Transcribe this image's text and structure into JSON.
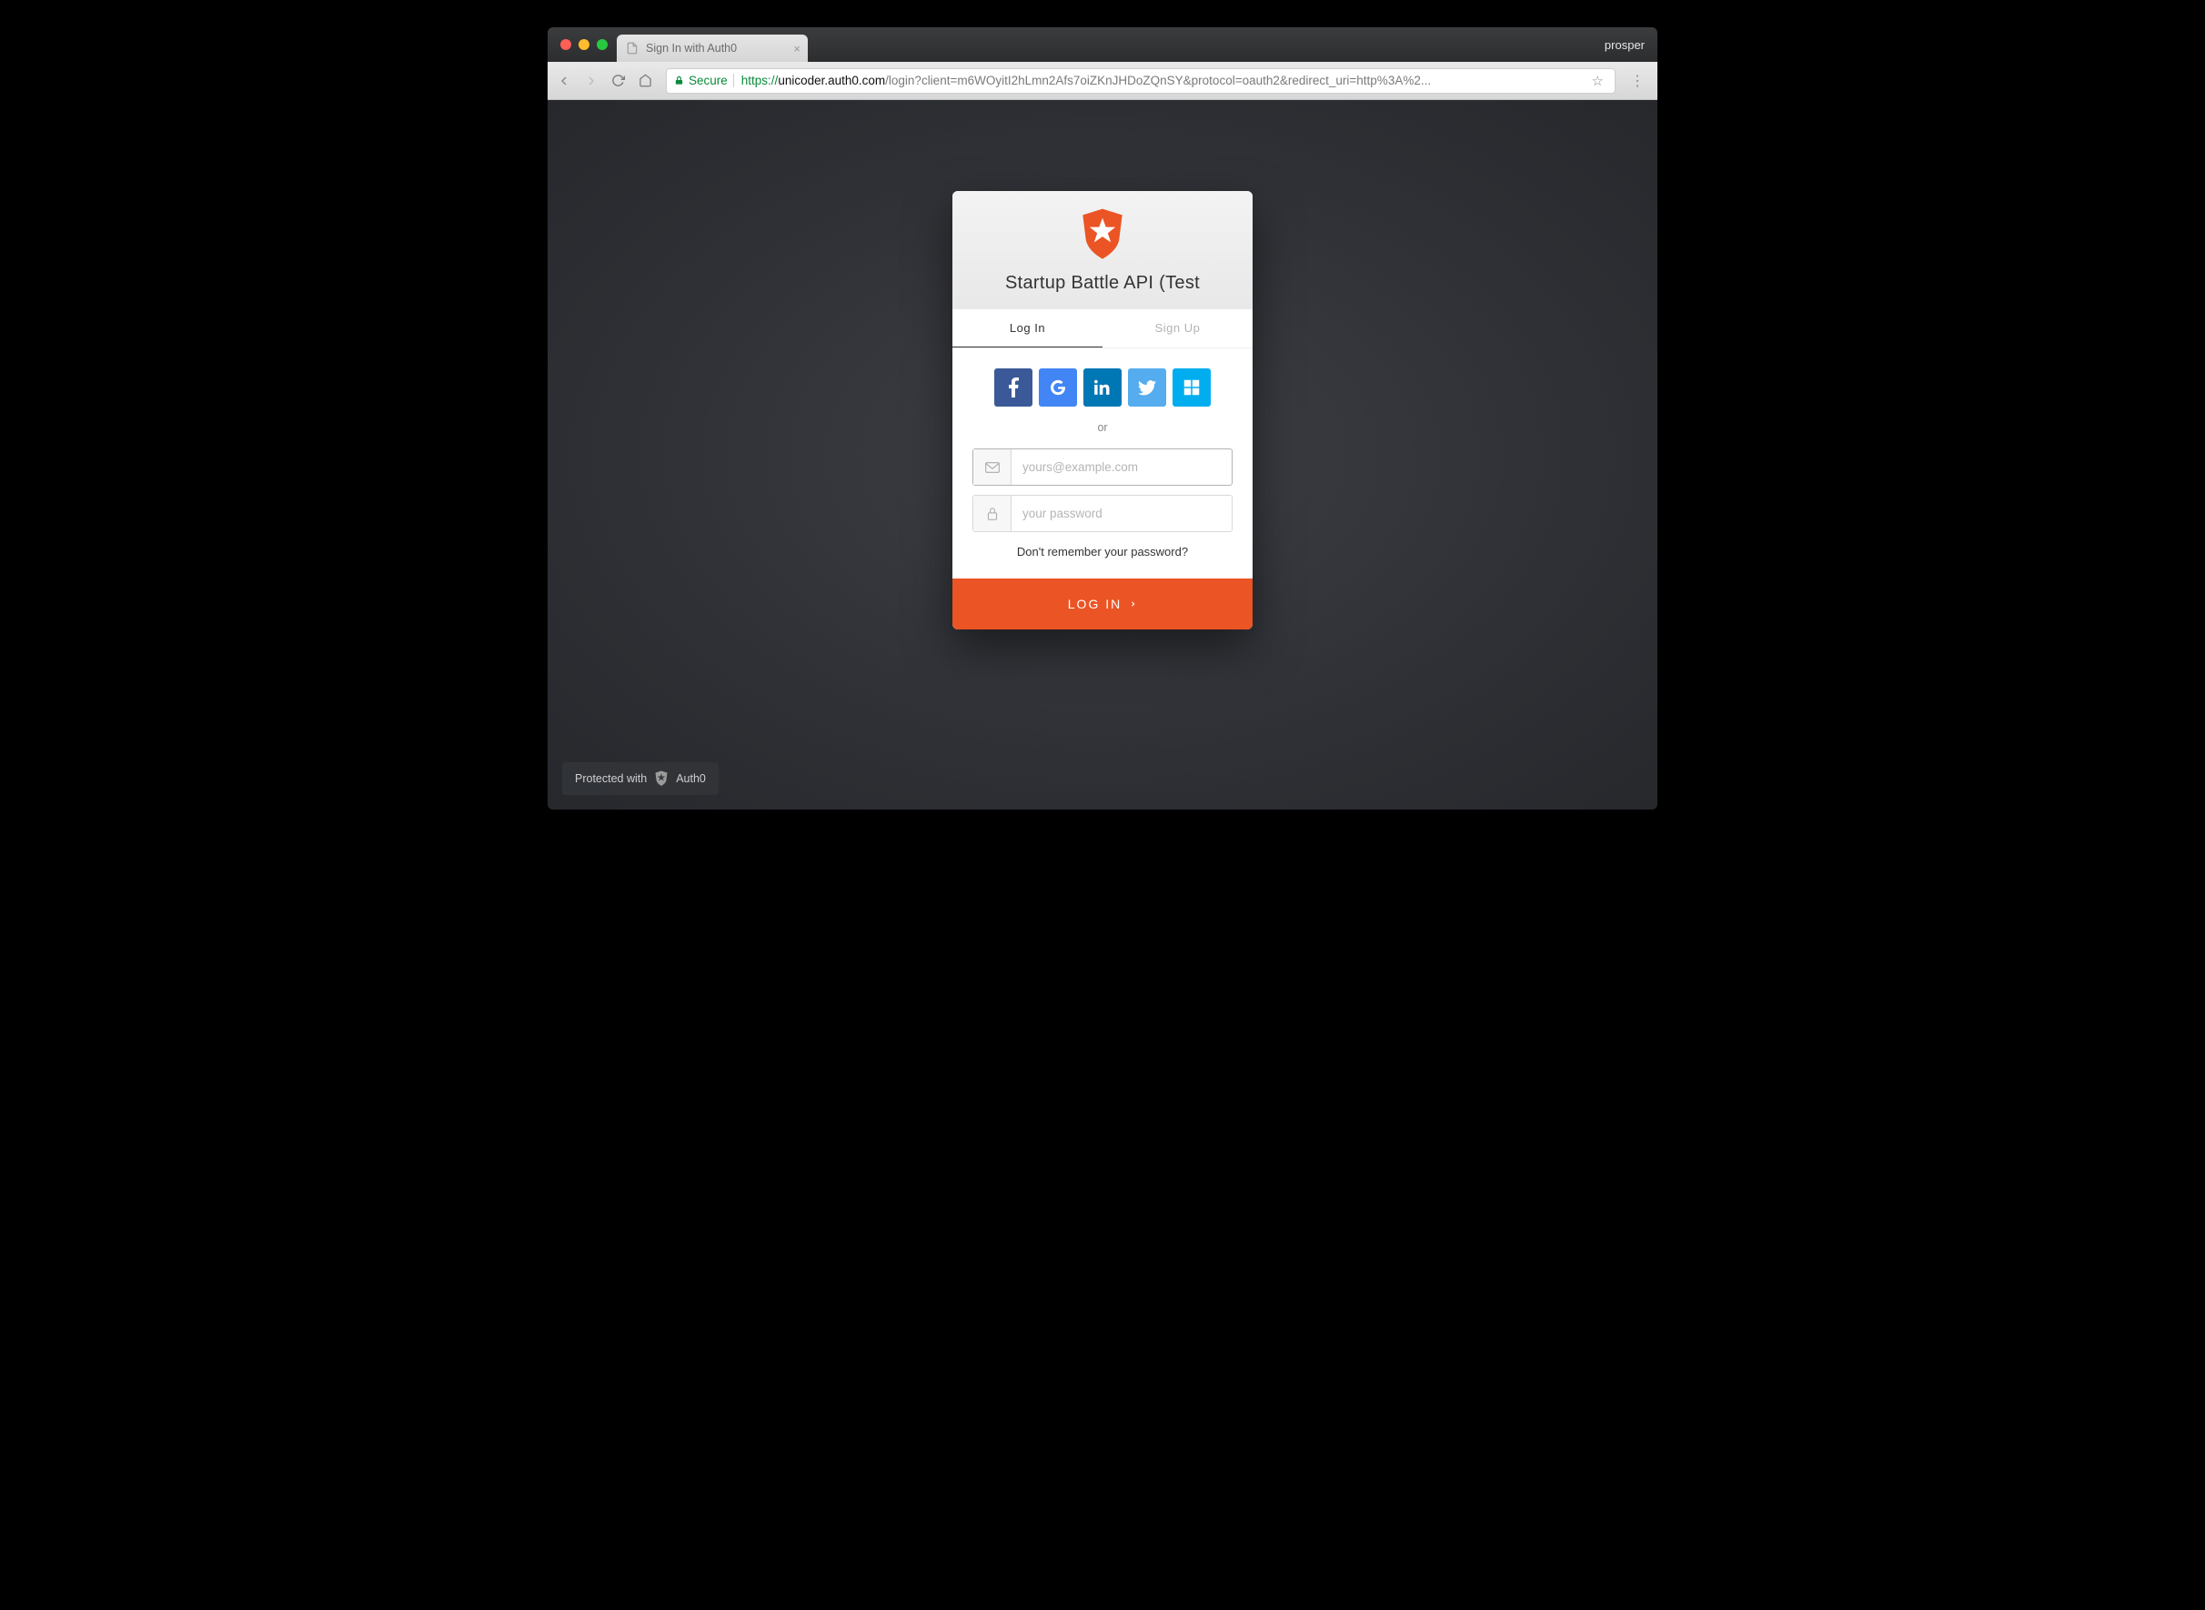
{
  "browser": {
    "tab_title": "Sign In with Auth0",
    "profile_name": "prosper",
    "secure_label": "Secure",
    "url_scheme": "https://",
    "url_host": "unicoder.auth0.com",
    "url_path": "/login?client=m6WOyitI2hLmn2Afs7oiZKnJHDoZQnSY&protocol=oauth2&redirect_uri=http%3A%2..."
  },
  "lock": {
    "title": "Startup Battle API (Test",
    "tabs": {
      "login": "Log In",
      "signup": "Sign Up"
    },
    "separator": "or",
    "email_placeholder": "yours@example.com",
    "password_placeholder": "your password",
    "forgot": "Don't remember your password?",
    "submit": "LOG IN"
  },
  "social": {
    "facebook": "facebook",
    "google": "google",
    "linkedin": "linkedin",
    "twitter": "twitter",
    "windows": "windows"
  },
  "badge": {
    "prefix": "Protected with",
    "brand": "Auth0"
  },
  "colors": {
    "accent": "#eb5424"
  }
}
